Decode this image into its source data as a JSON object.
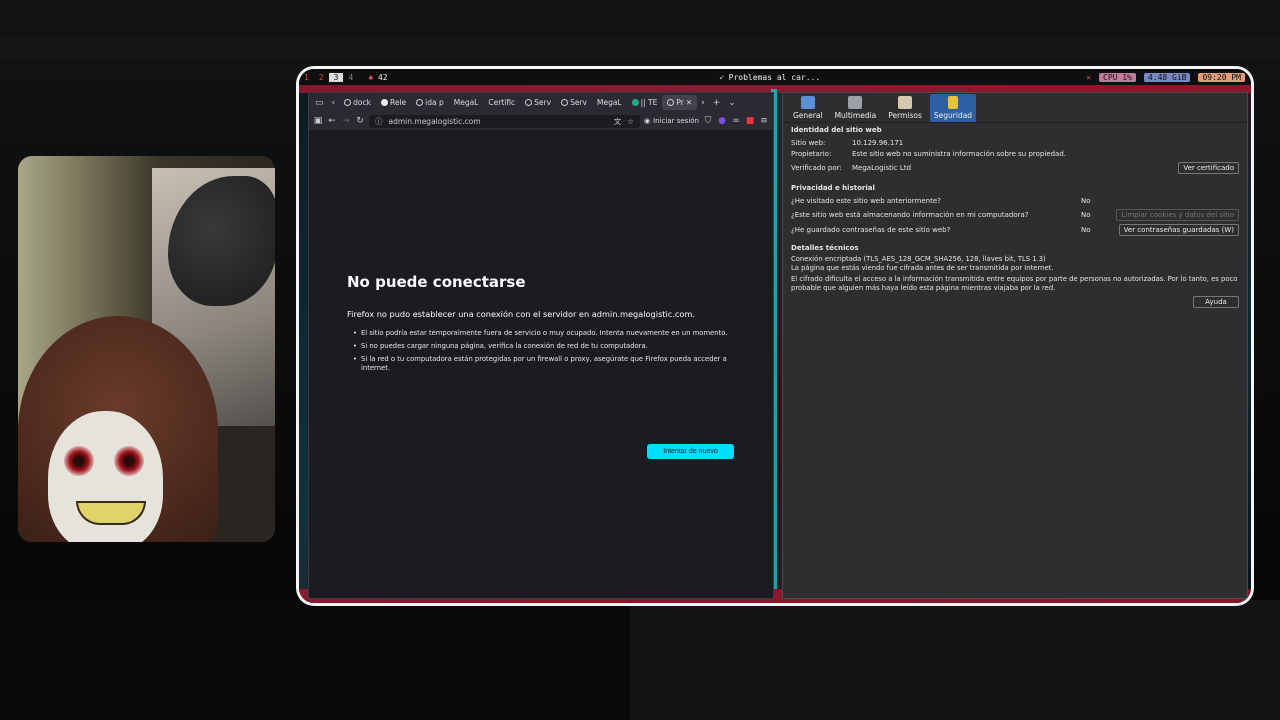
{
  "topbar": {
    "workspaces": [
      "1",
      "2",
      "3",
      "4"
    ],
    "active_workspace": "3",
    "notifications": "42",
    "window_title": "Problemas al car...",
    "cpu": "CPU 1%",
    "memory": "4.48 GiB",
    "clock": "09:20 PM"
  },
  "firefox": {
    "tabs": [
      "dock",
      "Rele",
      "ida p",
      "MegaL",
      "Certific",
      "Serv",
      "Serv",
      "MegaL",
      "|| TE",
      "Pr"
    ],
    "url": "admin.megalogistic.com",
    "signin_label": "Iniciar sesión",
    "error_title": "No puede conectarse",
    "error_lead": "Firefox no pudo establecer una conexión con el servidor en admin.megalogistic.com.",
    "bullets": [
      "El sitio podría estar temporalmente fuera de servicio o muy ocupado. Intenta nuevamente en un momento.",
      "Si no puedes cargar ninguna página, verifica la conexión de red de tu computadora.",
      "Si la red o tu computadora están protegidas por un firewall o proxy, asegúrate que Firefox pueda acceder a internet."
    ],
    "retry_label": "Intentar de nuevo"
  },
  "pageinfo": {
    "tabs": [
      "General",
      "Multimedia",
      "Permisos",
      "Seguridad"
    ],
    "identity_heading": "Identidad del sitio web",
    "site_label": "Sitio web:",
    "site_value": "10.129.96.171",
    "owner_label": "Propietario:",
    "owner_value": "Este sitio web no suministra información sobre su propiedad.",
    "verified_label": "Verificado por:",
    "verified_value": "MegaLogistic Ltd",
    "view_cert": "Ver certificado",
    "privacy_heading": "Privacidad e historial",
    "q1": "¿He visitado este sitio web anteriormente?",
    "a1": "No",
    "q2": "¿Este sitio web está almacenando información en mi computadora?",
    "a2": "No",
    "clear_cookies": "Limpiar cookies y datos del sitio",
    "q3": "¿He guardado contraseñas de este sitio web?",
    "a3": "No",
    "view_passwords": "Ver contraseñas guardadas (W)",
    "tech_heading": "Detalles técnicos",
    "tech1": "Conexión encriptada (TLS_AES_128_GCM_SHA256, 128, llaves bit, TLS 1.3)",
    "tech2": "La página que estás viendo fue cifrada antes de ser transmitida por Internet.",
    "tech3": "El cifrado dificulta el acceso a la información transmitida entre equipos por parte de personas no autorizadas. Por lo tanto, es poco probable que alguien más haya leído esta página mientras viajaba por la red.",
    "help": "Ayuda"
  }
}
